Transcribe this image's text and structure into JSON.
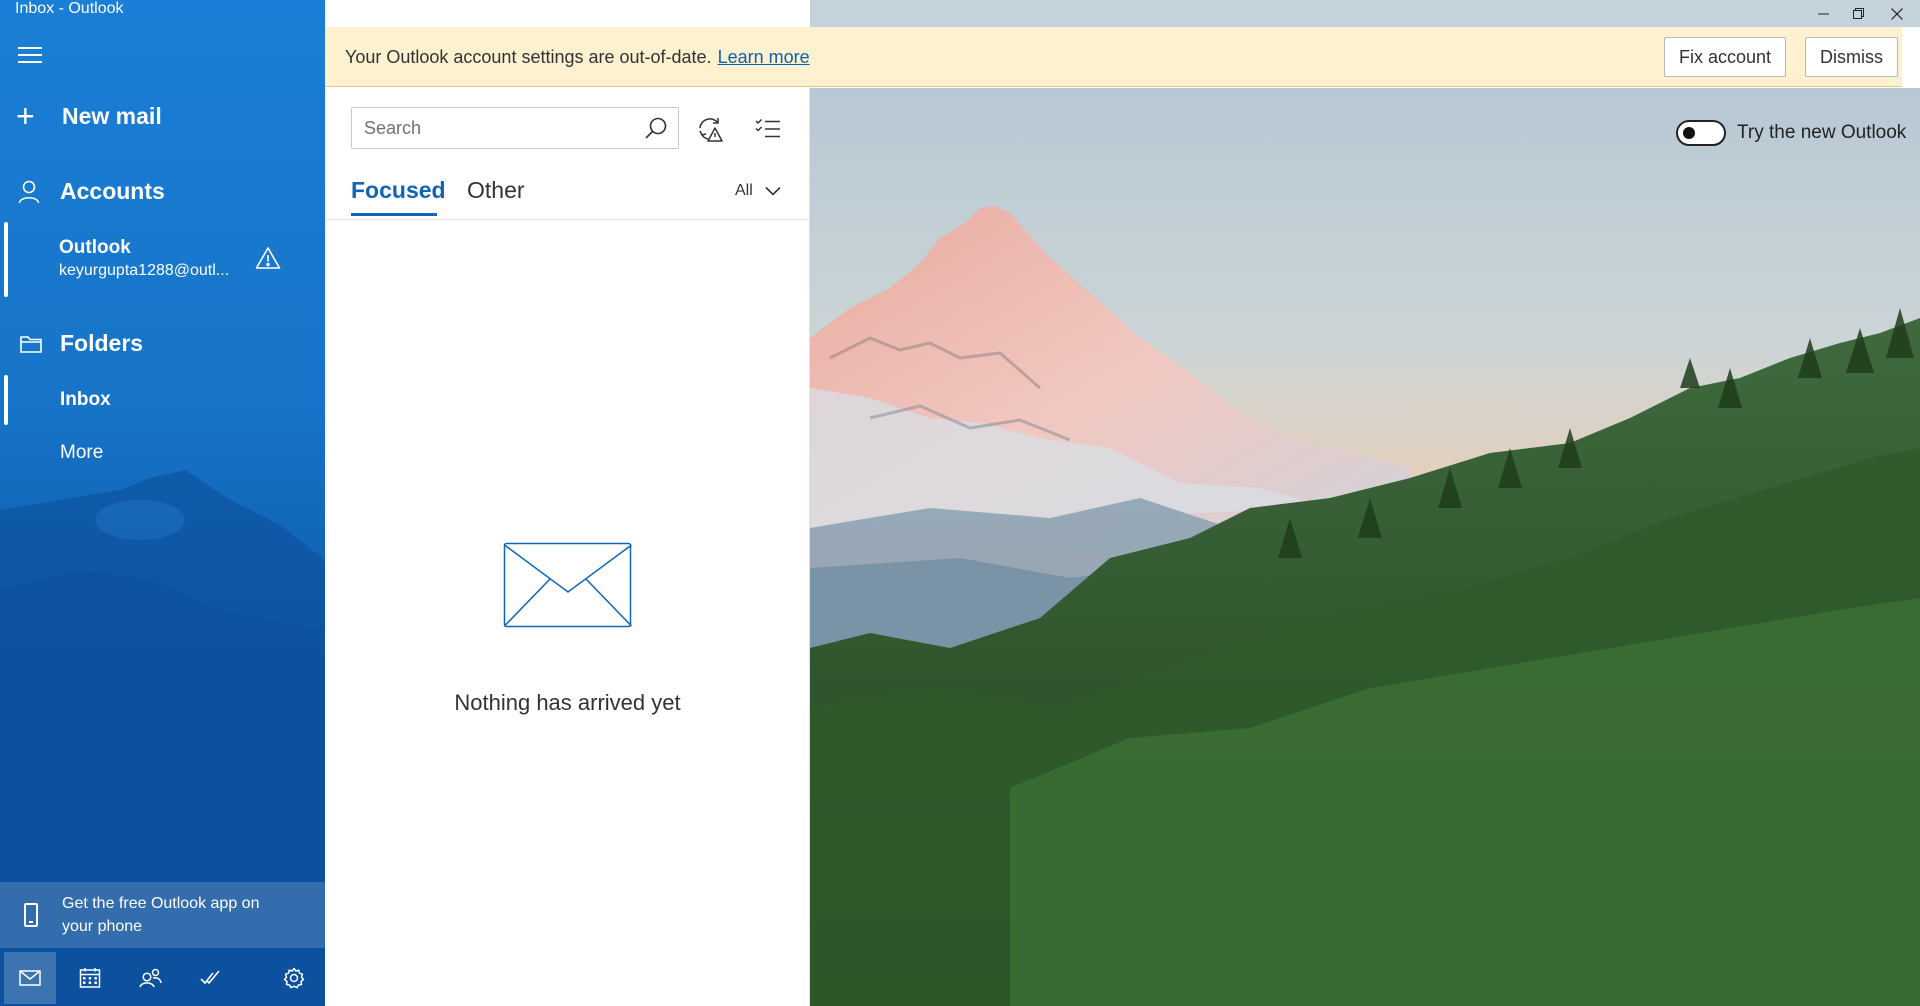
{
  "window": {
    "title": "Inbox - Outlook"
  },
  "sidebar": {
    "new_mail": "New mail",
    "accounts_label": "Accounts",
    "account": {
      "name": "Outlook",
      "email": "keyurgupta1288@outl..."
    },
    "folders_label": "Folders",
    "inbox": "Inbox",
    "more": "More",
    "promo": "Get the free Outlook app on your phone"
  },
  "bottom_nav": {
    "items": [
      "mail-icon",
      "calendar-icon",
      "people-icon",
      "todo-icon",
      "settings-icon"
    ],
    "active": "mail-icon"
  },
  "banner": {
    "message": "Your Outlook account settings are out-of-date.",
    "link": "Learn more",
    "fix": "Fix account",
    "dismiss": "Dismiss"
  },
  "search": {
    "placeholder": "Search"
  },
  "tabs": {
    "focused": "Focused",
    "other": "Other",
    "filter": "All"
  },
  "empty_state": {
    "message": "Nothing has arrived yet"
  },
  "reading_pane": {
    "toggle_label": "Try the new Outlook",
    "toggle_on": false
  },
  "colors": {
    "accent": "#1164b6",
    "sidebar": "#1774c8",
    "banner": "#fdf1cf"
  }
}
